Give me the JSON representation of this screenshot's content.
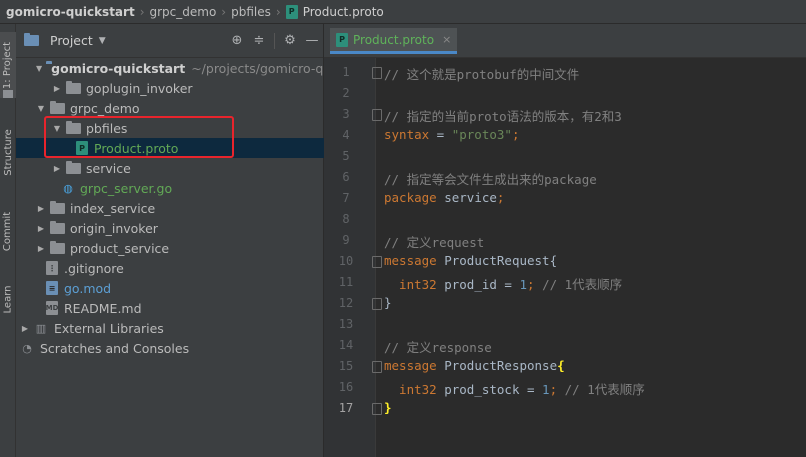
{
  "breadcrumb": {
    "items": [
      "gomicro-quickstart",
      "grpc_demo",
      "pbfiles",
      "Product.proto"
    ],
    "file_icon": "P"
  },
  "tool_windows": {
    "project": "1: Project",
    "structure": "Structure",
    "commit": "Commit",
    "learn": "Learn"
  },
  "project_panel": {
    "title": "Project",
    "dropdown_icon": "chevron-down-icon",
    "tool_icons": [
      "locate-icon",
      "collapse-icon",
      "gear-icon",
      "hide-icon"
    ]
  },
  "tree": [
    {
      "label": "gomicro-quickstart",
      "path": "~/projects/gomicro-quic",
      "type": "folder",
      "expanded": true
    },
    {
      "label": "goplugin_invoker",
      "type": "folder",
      "expanded": false
    },
    {
      "label": "grpc_demo",
      "type": "folder",
      "expanded": true
    },
    {
      "label": "pbfiles",
      "type": "folder",
      "expanded": true
    },
    {
      "label": "Product.proto",
      "type": "proto",
      "icon_text": "P",
      "selected": true
    },
    {
      "label": "service",
      "type": "folder",
      "expanded": false
    },
    {
      "label": "grpc_server.go",
      "type": "go"
    },
    {
      "label": "index_service",
      "type": "folder",
      "expanded": false
    },
    {
      "label": "origin_invoker",
      "type": "folder",
      "expanded": false
    },
    {
      "label": "product_service",
      "type": "folder",
      "expanded": false
    },
    {
      "label": ".gitignore",
      "type": "git"
    },
    {
      "label": "go.mod",
      "type": "mod"
    },
    {
      "label": "README.md",
      "type": "md",
      "icon_text": "MD"
    },
    {
      "label": "External Libraries",
      "type": "lib",
      "expanded": false
    },
    {
      "label": "Scratches and Consoles",
      "type": "scratch"
    }
  ],
  "editor": {
    "tab": {
      "icon_text": "P",
      "label": "Product.proto",
      "close": "×"
    },
    "current_line": 17,
    "lines": [
      {
        "n": "1",
        "parts": [
          {
            "t": "// 这个就是protobuf的中间文件",
            "c": "com"
          }
        ]
      },
      {
        "n": "2",
        "parts": []
      },
      {
        "n": "3",
        "parts": [
          {
            "t": "// 指定的当前proto语法的版本，有2和3",
            "c": "com"
          }
        ]
      },
      {
        "n": "4",
        "parts": [
          {
            "t": "syntax",
            "c": "kw"
          },
          {
            "t": " = ",
            "c": "plain"
          },
          {
            "t": "\"proto3\"",
            "c": "str"
          },
          {
            "t": ";",
            "c": "kw"
          }
        ]
      },
      {
        "n": "5",
        "parts": []
      },
      {
        "n": "6",
        "parts": [
          {
            "t": "// 指定等会文件生成出来的package",
            "c": "com"
          }
        ]
      },
      {
        "n": "7",
        "parts": [
          {
            "t": "package",
            "c": "kw"
          },
          {
            "t": " service",
            "c": "plain"
          },
          {
            "t": ";",
            "c": "kw"
          }
        ]
      },
      {
        "n": "8",
        "parts": []
      },
      {
        "n": "9",
        "parts": [
          {
            "t": "// 定义request",
            "c": "com"
          }
        ]
      },
      {
        "n": "10",
        "parts": [
          {
            "t": "message",
            "c": "kw"
          },
          {
            "t": " ProductRequest{",
            "c": "plain"
          }
        ]
      },
      {
        "n": "11",
        "parts": [
          {
            "t": "  int32",
            "c": "kw"
          },
          {
            "t": " prod_id = ",
            "c": "plain"
          },
          {
            "t": "1",
            "c": "num"
          },
          {
            "t": ";",
            "c": "kw"
          },
          {
            "t": " // 1代表顺序",
            "c": "com"
          }
        ]
      },
      {
        "n": "12",
        "parts": [
          {
            "t": "}",
            "c": "plain"
          }
        ]
      },
      {
        "n": "13",
        "parts": []
      },
      {
        "n": "14",
        "parts": [
          {
            "t": "// 定义response",
            "c": "com"
          }
        ]
      },
      {
        "n": "15",
        "parts": [
          {
            "t": "message",
            "c": "kw"
          },
          {
            "t": " ProductResponse",
            "c": "plain"
          },
          {
            "t": "{",
            "c": "brace-hl"
          }
        ]
      },
      {
        "n": "16",
        "parts": [
          {
            "t": "  int32",
            "c": "kw"
          },
          {
            "t": " prod_stock = ",
            "c": "plain"
          },
          {
            "t": "1",
            "c": "num"
          },
          {
            "t": ";",
            "c": "kw"
          },
          {
            "t": " // 1代表顺序",
            "c": "com"
          }
        ]
      },
      {
        "n": "17",
        "parts": [
          {
            "t": "}",
            "c": "brace-hl"
          }
        ]
      }
    ]
  },
  "colors": {
    "selection": "#0d293e",
    "highlight_box": "#e8242c",
    "keyword": "#cc7832",
    "comment": "#808080",
    "string": "#6a8759",
    "number": "#6897bb"
  }
}
